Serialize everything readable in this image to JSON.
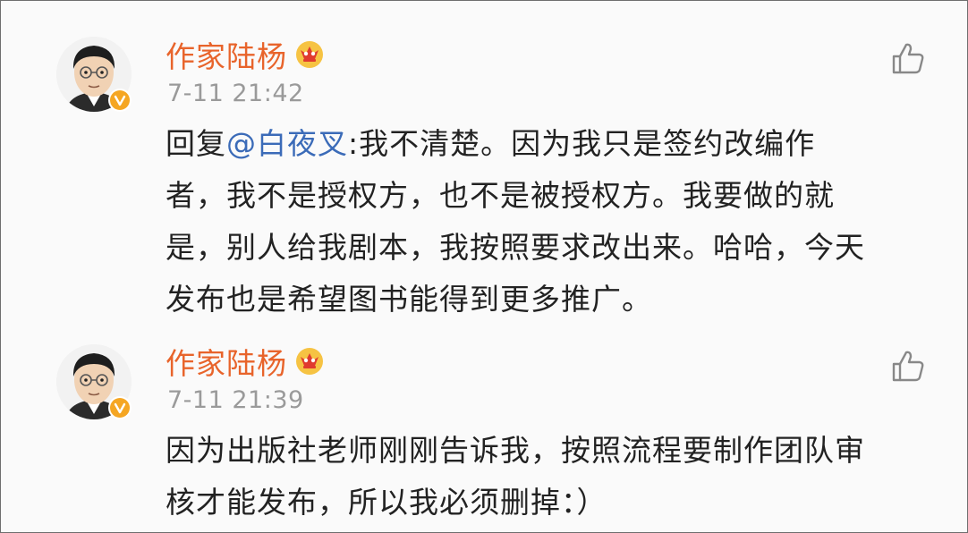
{
  "comments": [
    {
      "author": "作家陆杨",
      "time": "7-11 21:42",
      "reply_prefix": "回复",
      "mention": "@白夜叉",
      "lines": [
        ":我不清楚。因为我只是签约改编作",
        "者，我不是授权方，也不是被授权方。我要做的就",
        "是，别人给我剧本，我按照要求改出来。哈哈，今天",
        "发布也是希望图书能得到更多推广。"
      ]
    },
    {
      "author": "作家陆杨",
      "time": "7-11 21:39",
      "lines": [
        "因为出版社老师刚刚告诉我，按照流程要制作团队审",
        "核才能发布，所以我必须删掉：）"
      ]
    }
  ],
  "icons": {
    "avatar": "cartoon-avatar-icon",
    "verified": "verified-badge-icon",
    "vip": "crown-icon",
    "like": "thumbs-up-icon"
  },
  "colors": {
    "author": "#e8642b",
    "mention": "#3b6bb8",
    "time": "#9a9a9a",
    "text": "#222222",
    "verified": "#f5a623"
  }
}
